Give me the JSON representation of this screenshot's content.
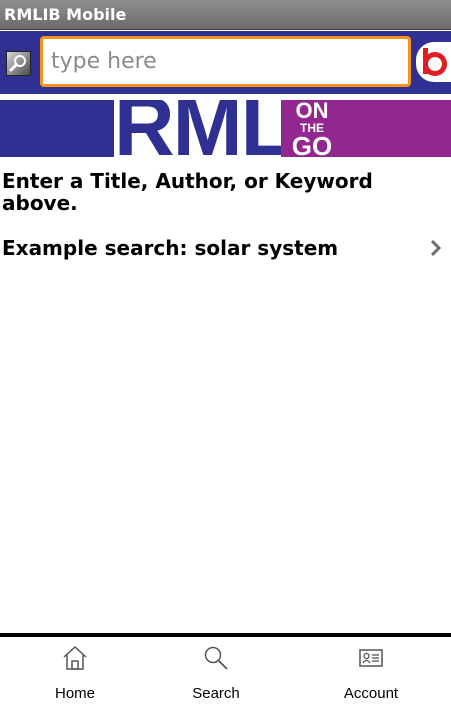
{
  "app": {
    "title": "RMLIB Mobile"
  },
  "search": {
    "placeholder": "type here",
    "value": ""
  },
  "banner": {
    "left_text": "RML",
    "on": "ON",
    "the": "THE",
    "go": "GO"
  },
  "content": {
    "instructions": "Enter a Title, Author, or Keyword above.",
    "example": "Example search: solar system"
  },
  "tabs": [
    {
      "label": "Home",
      "icon": "home-icon"
    },
    {
      "label": "Search",
      "icon": "search-icon"
    },
    {
      "label": "Account",
      "icon": "account-card-icon"
    }
  ],
  "colors": {
    "brand_blue": "#2f3192",
    "brand_purple": "#92278f",
    "input_border": "#f7931d",
    "logo_red": "#e31b23"
  }
}
